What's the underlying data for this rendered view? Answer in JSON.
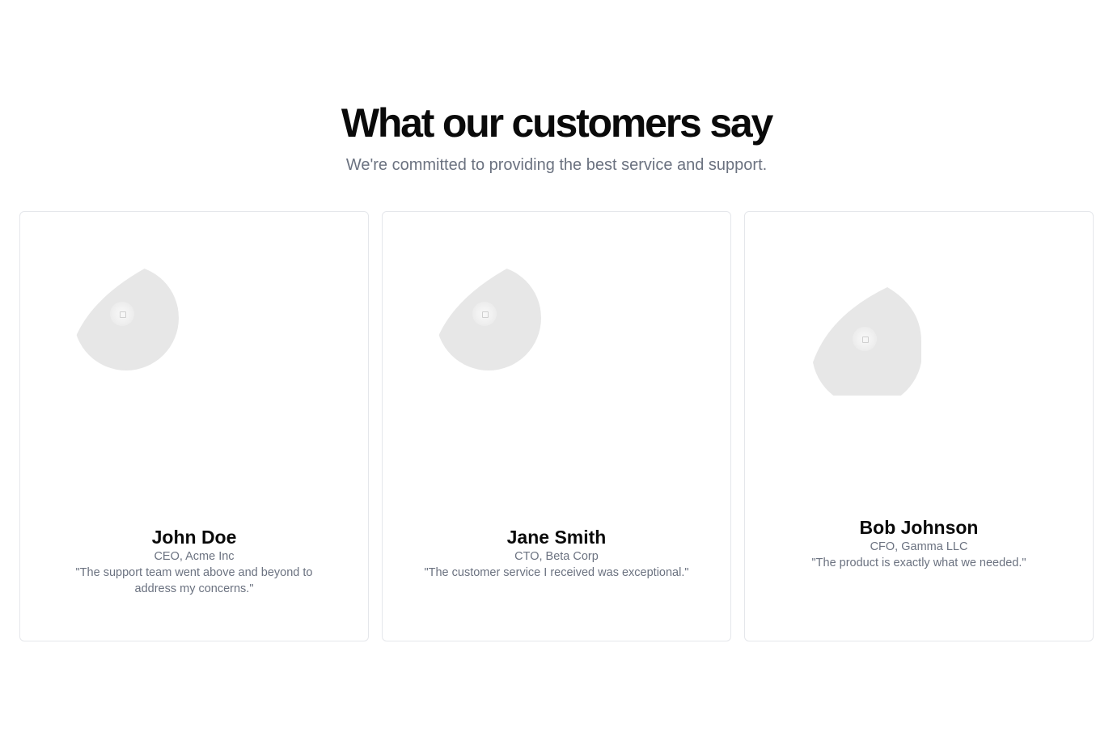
{
  "header": {
    "title": "What our customers say",
    "subtitle": "We're committed to providing the best service and support."
  },
  "testimonials": [
    {
      "name": "John Doe",
      "role": "CEO, Acme Inc",
      "quote": "\"The support team went above and beyond to address my concerns.\""
    },
    {
      "name": "Jane Smith",
      "role": "CTO, Beta Corp",
      "quote": "\"The customer service I received was exceptional.\""
    },
    {
      "name": "Bob Johnson",
      "role": "CFO, Gamma LLC",
      "quote": "\"The product is exactly what we needed.\""
    }
  ],
  "colors": {
    "heading": "#0a0a0a",
    "muted": "#6b7280",
    "card_border": "#e5e7eb",
    "placeholder": "#e7e7e7"
  }
}
